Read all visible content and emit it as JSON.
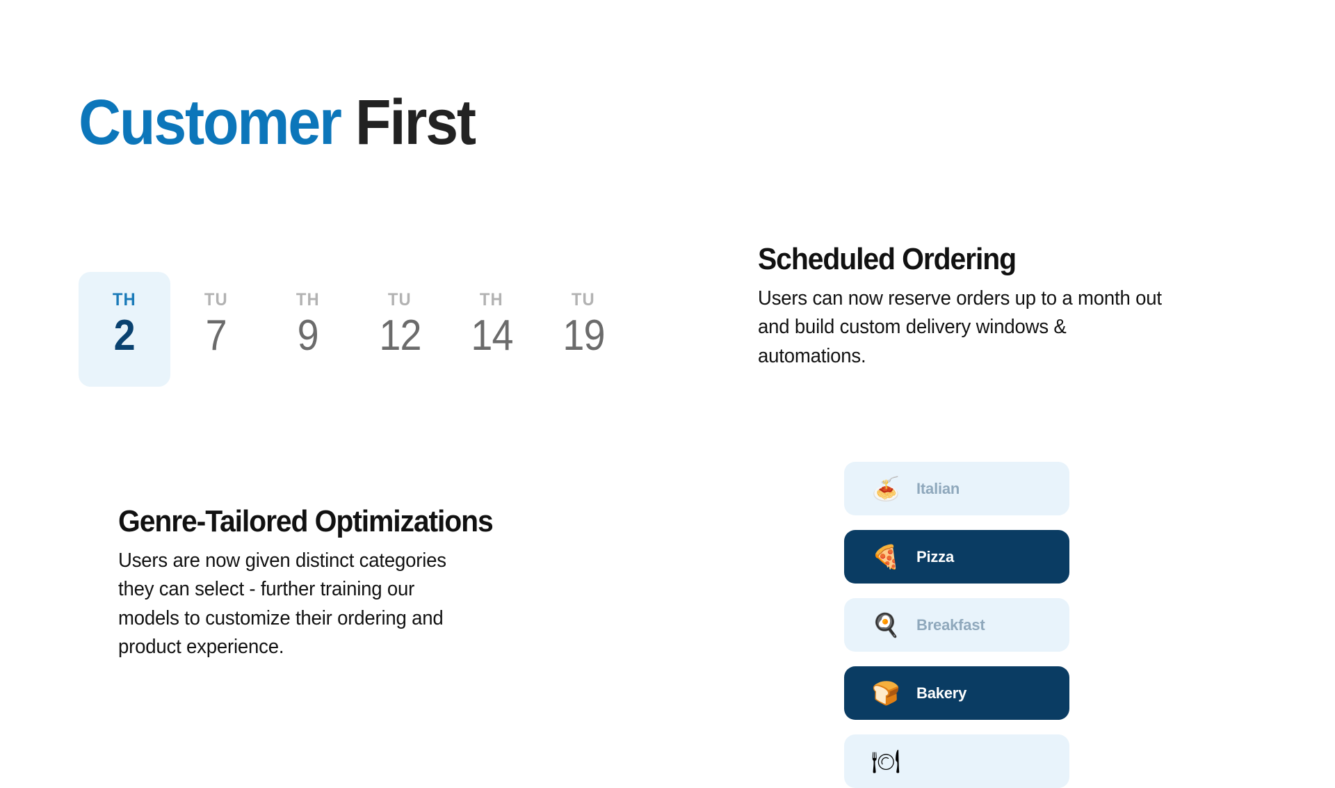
{
  "header": {
    "title_accent": "Customer",
    "title_rest": "First",
    "accent_color": "#0c76ba",
    "rest_color": "#222222"
  },
  "date_picker": {
    "selected_index": 0,
    "selected_bg": "#e9f4fb",
    "selected_dow_color": "#1a7ab8",
    "selected_num_color": "#0a4270",
    "idle_dow_color": "#b2b2b2",
    "idle_num_color": "#6b6b6b",
    "dates": [
      {
        "dow": "TH",
        "day": "2",
        "selected": true
      },
      {
        "dow": "TU",
        "day": "7",
        "selected": false
      },
      {
        "dow": "TH",
        "day": "9",
        "selected": false
      },
      {
        "dow": "TU",
        "day": "12",
        "selected": false
      },
      {
        "dow": "TH",
        "day": "14",
        "selected": false
      },
      {
        "dow": "TU",
        "day": "19",
        "selected": false
      }
    ]
  },
  "features": [
    {
      "id": "scheduled",
      "heading": "Scheduled Ordering",
      "body": "Users can now reserve orders up to a month out and build custom delivery windows & automations."
    },
    {
      "id": "genre",
      "heading": "Genre-Tailored Optimizations",
      "body": "Users are now given distinct categories they can select - further training our models to customize their ordering and product experience."
    }
  ],
  "categories": {
    "active_bg": "#0a3c63",
    "idle_bg": "#e8f3fb",
    "idle_label_color": "#8fa8bc",
    "active_label_color": "#ffffff",
    "items": [
      {
        "label": "Italian",
        "emoji": "🍝",
        "icon_name": "spaghetti-icon",
        "active": false
      },
      {
        "label": "Pizza",
        "emoji": "🍕",
        "icon_name": "pizza-icon",
        "active": true
      },
      {
        "label": "Breakfast",
        "emoji": "🍳",
        "icon_name": "fried-egg-icon",
        "active": false
      },
      {
        "label": "Bakery",
        "emoji": "🍞",
        "icon_name": "bread-icon",
        "active": true
      },
      {
        "label": "",
        "emoji": "🍽",
        "icon_name": "fork-knife-plate-icon",
        "active": false
      }
    ]
  }
}
